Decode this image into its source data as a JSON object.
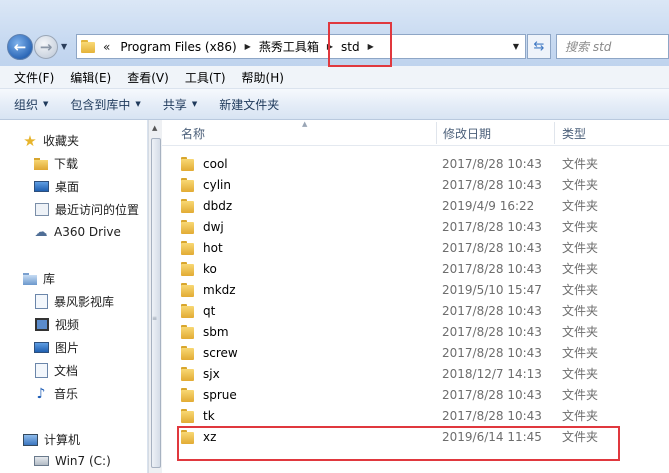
{
  "address_bar": {
    "overflow": "«",
    "crumbs": [
      {
        "label": "Program Files (x86)"
      },
      {
        "label": "燕秀工具箱"
      },
      {
        "label": "std"
      }
    ],
    "search_placeholder": "搜索 std"
  },
  "menu": [
    "文件(F)",
    "编辑(E)",
    "查看(V)",
    "工具(T)",
    "帮助(H)"
  ],
  "toolbar": {
    "organize": "组织",
    "include_in_library": "包含到库中",
    "share": "共享",
    "new_folder": "新建文件夹"
  },
  "nav": {
    "favorites": "收藏夹",
    "downloads": "下载",
    "desktop": "桌面",
    "recent": "最近访问的位置",
    "a360": "A360 Drive",
    "libraries": "库",
    "storm": "暴风影视库",
    "videos": "视频",
    "pictures": "图片",
    "documents": "文档",
    "music": "音乐",
    "computer": "计算机",
    "win7": "Win7 (C:)"
  },
  "columns": {
    "name": "名称",
    "date": "修改日期",
    "type": "类型"
  },
  "files": [
    {
      "name": "cool",
      "date": "2017/8/28 10:43",
      "type": "文件夹"
    },
    {
      "name": "cylin",
      "date": "2017/8/28 10:43",
      "type": "文件夹"
    },
    {
      "name": "dbdz",
      "date": "2019/4/9 16:22",
      "type": "文件夹"
    },
    {
      "name": "dwj",
      "date": "2017/8/28 10:43",
      "type": "文件夹"
    },
    {
      "name": "hot",
      "date": "2017/8/28 10:43",
      "type": "文件夹"
    },
    {
      "name": "ko",
      "date": "2017/8/28 10:43",
      "type": "文件夹"
    },
    {
      "name": "mkdz",
      "date": "2019/5/10 15:47",
      "type": "文件夹"
    },
    {
      "name": "qt",
      "date": "2017/8/28 10:43",
      "type": "文件夹"
    },
    {
      "name": "sbm",
      "date": "2017/8/28 10:43",
      "type": "文件夹"
    },
    {
      "name": "screw",
      "date": "2017/8/28 10:43",
      "type": "文件夹"
    },
    {
      "name": "sjx",
      "date": "2018/12/7 14:13",
      "type": "文件夹"
    },
    {
      "name": "sprue",
      "date": "2017/8/28 10:43",
      "type": "文件夹"
    },
    {
      "name": "tk",
      "date": "2017/8/28 10:43",
      "type": "文件夹"
    },
    {
      "name": "xz",
      "date": "2019/6/14 11:45",
      "type": "文件夹"
    }
  ],
  "annotation_color": "#e0383e"
}
